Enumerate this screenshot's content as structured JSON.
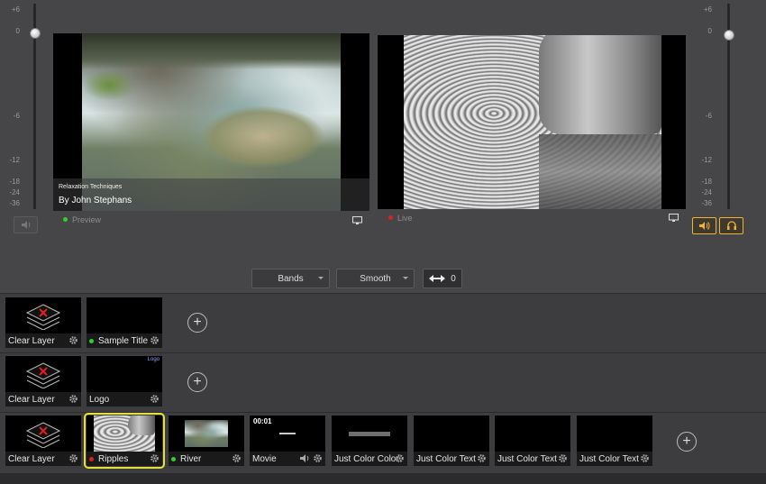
{
  "meters": {
    "left_scale": [
      "+6",
      "0",
      "-6",
      "-12",
      "-18",
      "-24",
      "-36"
    ],
    "right_scale": [
      "+6",
      "0",
      "-6",
      "-12",
      "-18",
      "-24",
      "-36"
    ]
  },
  "preview": {
    "label": "Preview",
    "overlay_title_small": "Relaxation Techniques",
    "overlay_title_big": "By John Stephans"
  },
  "live": {
    "label": "Live"
  },
  "transition": {
    "effect": "Bands",
    "style": "Smooth",
    "duration_value": "0"
  },
  "layers": [
    {
      "shots": [
        {
          "name": "Clear Layer",
          "type": "clear"
        },
        {
          "name": "Sample Title",
          "type": "title",
          "status": "green"
        }
      ]
    },
    {
      "shots": [
        {
          "name": "Clear Layer",
          "type": "clear"
        },
        {
          "name": "Logo",
          "type": "logo",
          "thumb_text": "Logo"
        }
      ]
    },
    {
      "shots": [
        {
          "name": "Clear Layer",
          "type": "clear"
        },
        {
          "name": "Ripples",
          "type": "video",
          "status": "red",
          "selected": true
        },
        {
          "name": "River",
          "type": "video",
          "status": "green"
        },
        {
          "name": "Movie",
          "type": "movie",
          "thumb_text": "00:01"
        },
        {
          "name": "Just Color Color",
          "type": "color"
        },
        {
          "name": "Just Color Text",
          "type": "color"
        },
        {
          "name": "Just Color Text",
          "type": "color"
        },
        {
          "name": "Just Color Text",
          "type": "color"
        }
      ]
    }
  ],
  "colors": {
    "status_live": "#e02020",
    "status_preview": "#2ed12e",
    "selection": "#e6e03a",
    "audio_active": "#f0b23a"
  }
}
